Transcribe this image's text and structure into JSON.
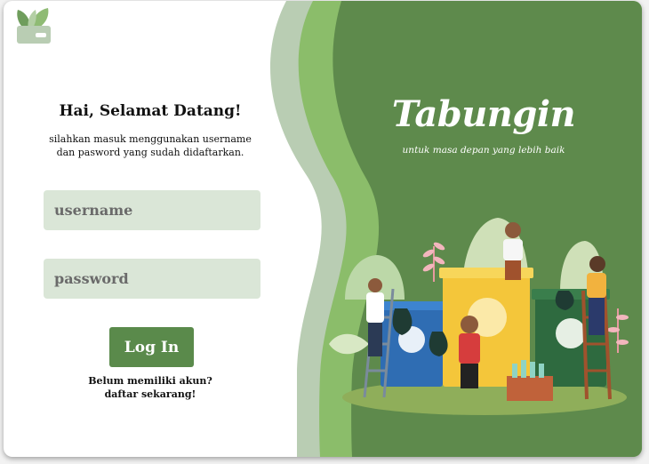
{
  "colors": {
    "primary_green": "#5a8a4b",
    "dark_green": "#5e8a4c",
    "field_bg": "#dae6d7",
    "light_green": "#8bbd6a",
    "pale_green": "#b9cdb3"
  },
  "login": {
    "welcome": "Hai, Selamat Datang!",
    "subtitle": "silahkan masuk menggunakan username dan pasword yang sudah didaftarkan.",
    "username_placeholder": "username",
    "password_placeholder": "password",
    "login_button": "Log In",
    "no_account": "Belum memiliki akun?",
    "signup_link": "daftar sekarang!"
  },
  "brand": {
    "name": "Tabungin",
    "tagline": "untuk masa depan yang lebih baik"
  },
  "icons": {
    "logo": "leaf-wallet-icon",
    "illustration": "recycling-kids-illustration"
  }
}
